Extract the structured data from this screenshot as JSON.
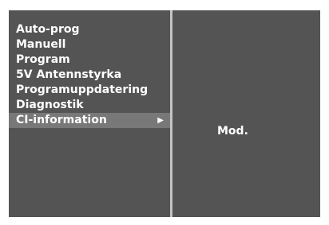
{
  "menu": {
    "items": [
      {
        "label": "Auto-prog"
      },
      {
        "label": "Manuell"
      },
      {
        "label": "Program"
      },
      {
        "label": "5V Antennstyrka"
      },
      {
        "label": "Programuppdatering"
      },
      {
        "label": "Diagnostik"
      },
      {
        "label": "CI-information",
        "selected": true,
        "has_submenu": true
      }
    ],
    "submenu_arrow_icon": "triangle-right-icon"
  },
  "submenu": {
    "label": "Mod."
  },
  "colors": {
    "panel_background": "#545454",
    "selected_highlight": "#787878",
    "divider": "#c4c4c4",
    "text": "#ffffff"
  }
}
